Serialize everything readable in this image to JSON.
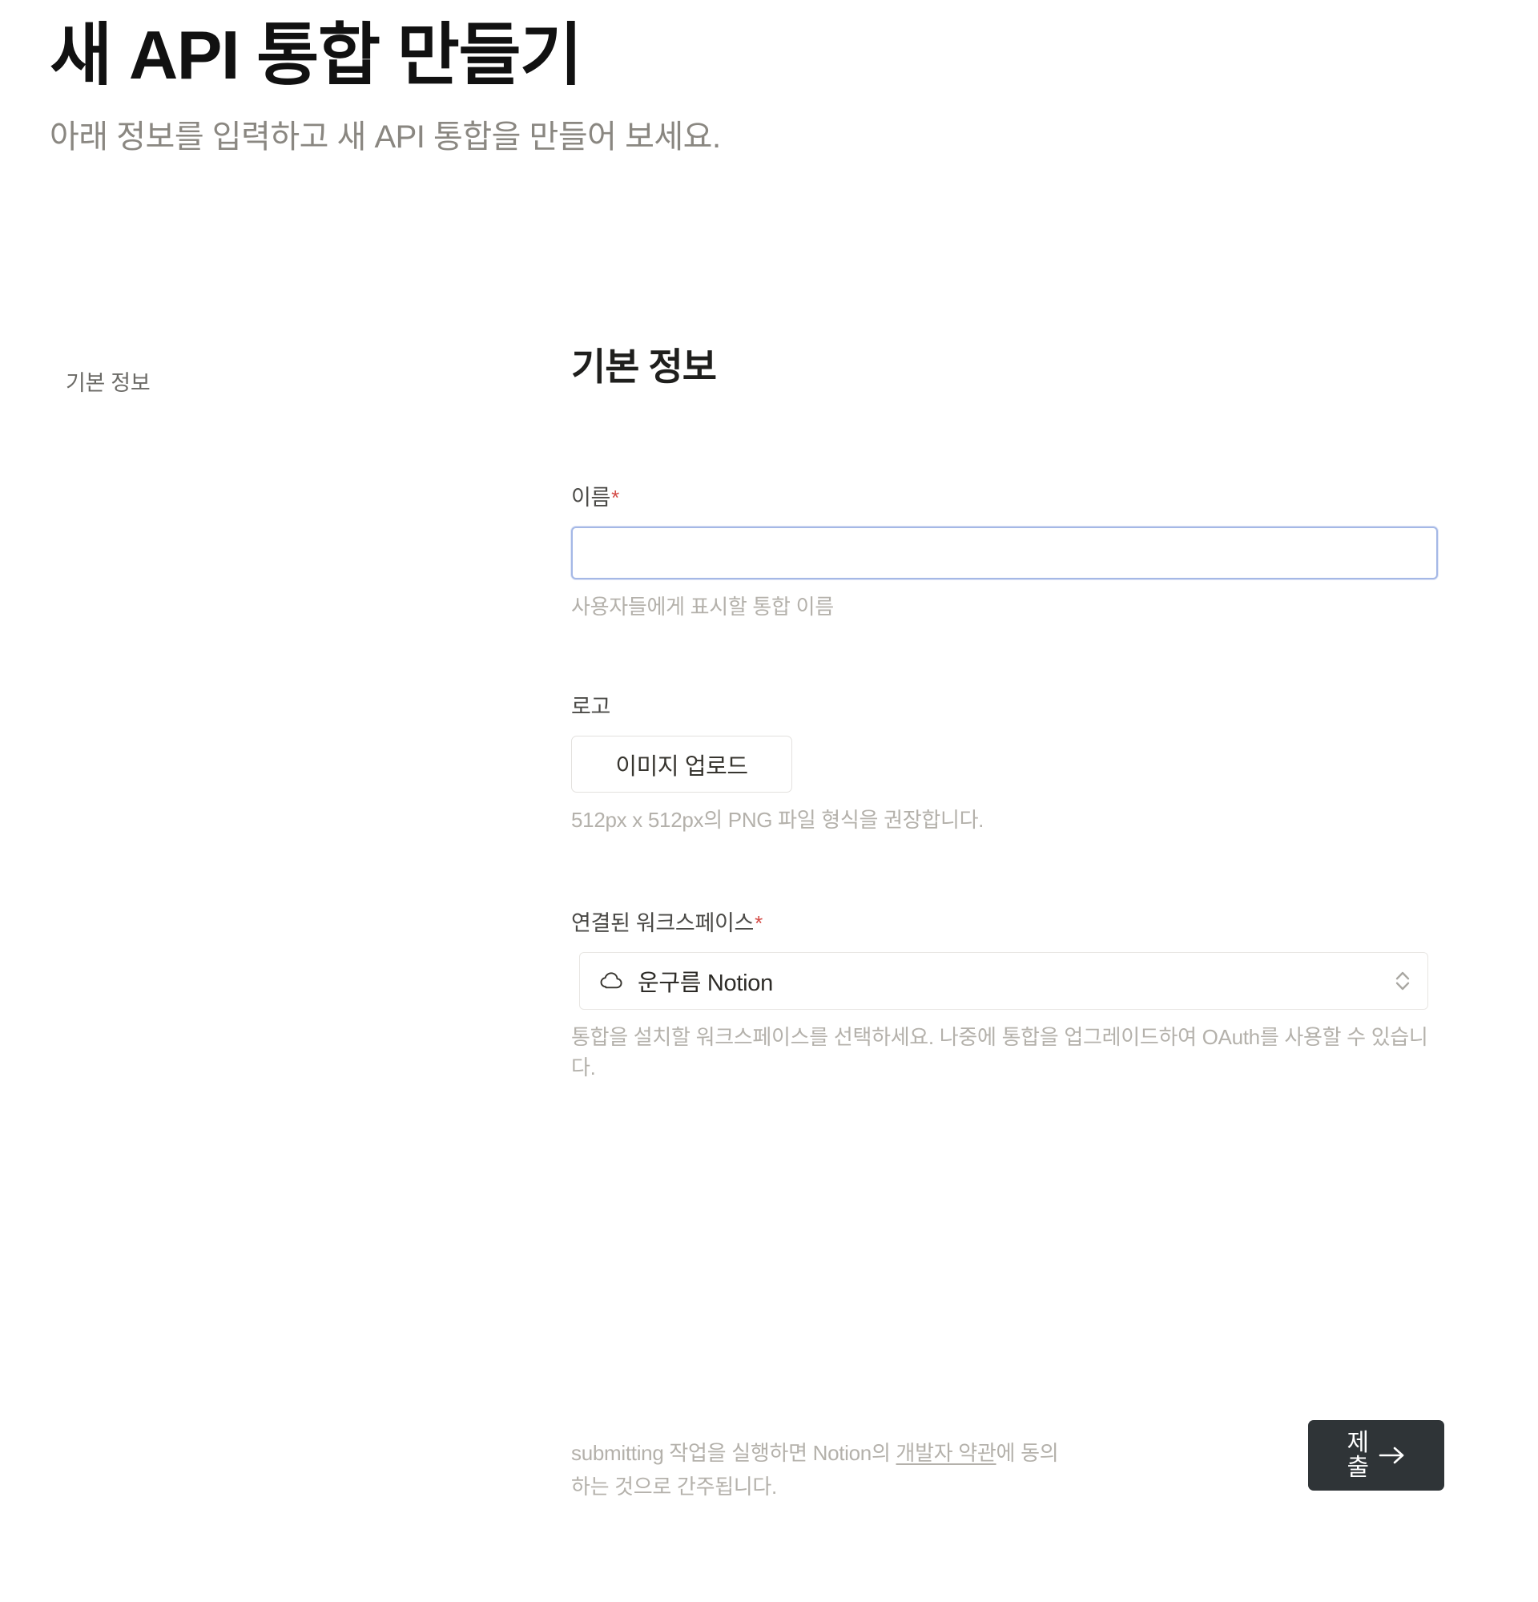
{
  "header": {
    "title": "새 API 통합 만들기",
    "subtitle": "아래 정보를 입력하고 새 API 통합을 만들어 보세요."
  },
  "sidebar": {
    "items": [
      {
        "label": "기본 정보"
      }
    ]
  },
  "main": {
    "section_title": "기본 정보",
    "fields": {
      "name": {
        "label": "이름",
        "required_marker": "*",
        "value": "",
        "placeholder": "",
        "hint": "사용자들에게 표시할 통합 이름"
      },
      "logo": {
        "label": "로고",
        "upload_button": "이미지 업로드",
        "hint": "512px x 512px의 PNG 파일 형식을 권장합니다."
      },
      "workspace": {
        "label": "연결된 워크스페이스",
        "required_marker": "*",
        "icon": "cloud-icon",
        "selected": "운구름 Notion",
        "options": [
          "운구름 Notion"
        ],
        "hint": "통합을 설치할 워크스페이스를 선택하세요. 나중에 통합을 업그레이드하여 OAuth를 사용할 수 있습니다."
      }
    }
  },
  "footer": {
    "terms_prefix": "submitting 작업을 실행하면 Notion의 ",
    "terms_link": "개발자 약관",
    "terms_suffix": "에 동의하는 것으로 간주됩니다.",
    "submit_label": "제출",
    "submit_arrow_icon": "arrow-right-icon"
  },
  "colors": {
    "accent_required": "#d44c47",
    "input_focus_border": "#a5b8e6",
    "submit_background": "#2f3437",
    "muted_text": "#b4b1ab"
  }
}
